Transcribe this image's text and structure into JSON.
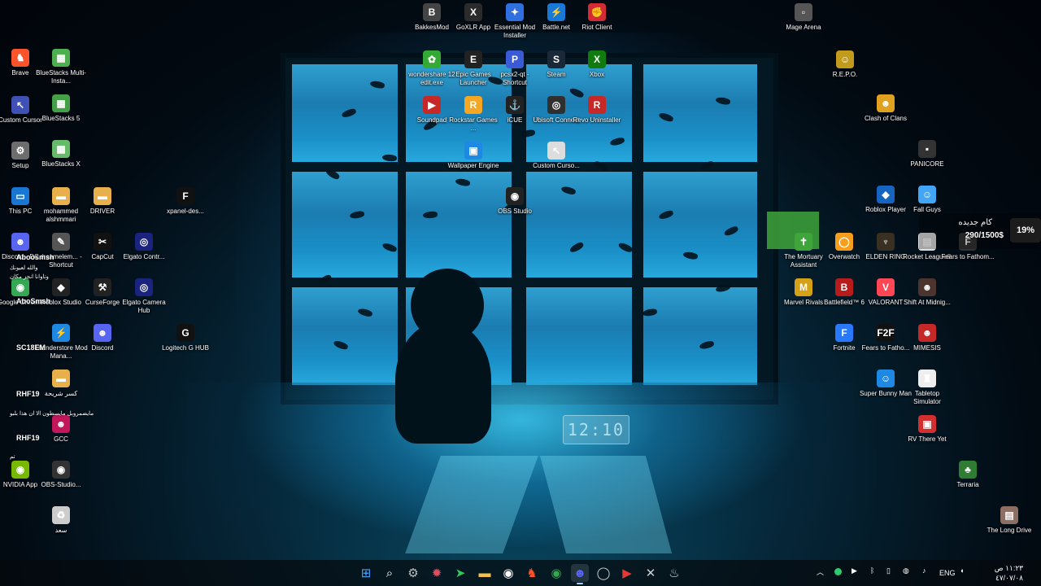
{
  "desktop": {
    "icons": [
      {
        "label": "BakkesMod",
        "color": "#444",
        "glyph": "B"
      },
      {
        "label": "GoXLR App",
        "color": "#2b2b2b",
        "glyph": "X"
      },
      {
        "label": "Essential Mod Installer",
        "color": "#2f6fe0",
        "glyph": "✦"
      },
      {
        "label": "Battle.net",
        "color": "#1a78d6",
        "glyph": "⚡"
      },
      {
        "label": "Riot Client",
        "color": "#d32b36",
        "glyph": "✊"
      },
      {
        "label": "Mage Arena",
        "color": "#555",
        "glyph": "▫"
      },
      {
        "label": "wondershare 12 edit.exe",
        "color": "#3a3",
        "glyph": "✿"
      },
      {
        "label": "Epic Games Launcher",
        "color": "#222",
        "glyph": "E"
      },
      {
        "label": "pcsx2-qt - Shortcut",
        "color": "#3b5bd6",
        "glyph": "P"
      },
      {
        "label": "Steam",
        "color": "#1b2838",
        "glyph": "S"
      },
      {
        "label": "Xbox",
        "color": "#107c10",
        "glyph": "X"
      },
      {
        "label": "R.E.P.O.",
        "color": "#c29a1c",
        "glyph": "☺"
      },
      {
        "label": "Brave",
        "color": "#fb542b",
        "glyph": "♞"
      },
      {
        "label": "BlueStacks Multi-Insta...",
        "color": "#4caf50",
        "glyph": "▦"
      },
      {
        "label": "Soundpad",
        "color": "#c62828",
        "glyph": "▶"
      },
      {
        "label": "Rockstar Games ...",
        "color": "#f5a623",
        "glyph": "R"
      },
      {
        "label": "iCUE",
        "color": "#222",
        "glyph": "⚓"
      },
      {
        "label": "Ubisoft Connect",
        "color": "#2f2f2f",
        "glyph": "◎"
      },
      {
        "label": "Revo Uninstaller",
        "color": "#c62828",
        "glyph": "R"
      },
      {
        "label": "Clash of Clans",
        "color": "#e0a020",
        "glyph": "☻"
      },
      {
        "label": "Custom Cursor",
        "color": "#3f51b5",
        "glyph": "↖"
      },
      {
        "label": "BlueStacks 5",
        "color": "#43a047",
        "glyph": "▦"
      },
      {
        "label": "Wallpaper Engine",
        "color": "#1e88e5",
        "glyph": "▣"
      },
      {
        "label": "Custom Curso...",
        "color": "#ddd",
        "glyph": "↖"
      },
      {
        "label": "PANICORE",
        "color": "#333",
        "glyph": "▪"
      },
      {
        "label": "Setup",
        "color": "#6d6d6d",
        "glyph": "⚙"
      },
      {
        "label": "BlueStacks X",
        "color": "#66bb6a",
        "glyph": "▦"
      },
      {
        "label": "OBS Studio",
        "color": "#222",
        "glyph": "◉"
      },
      {
        "label": "This PC",
        "color": "#1976d2",
        "glyph": "▭"
      },
      {
        "label": "mohammed alshmmari",
        "color": "#e8b04a",
        "glyph": "▬"
      },
      {
        "label": "DRIVER",
        "color": "#e8b04a",
        "glyph": "▬"
      },
      {
        "label": "xpanel-des...",
        "color": "#111",
        "glyph": "F"
      },
      {
        "label": "Roblox Player",
        "color": "#1565c0",
        "glyph": "◆"
      },
      {
        "label": "Fall Guys",
        "color": "#42a5f5",
        "glyph": "☺"
      },
      {
        "label": "Discord - DC",
        "color": "#5865f2",
        "glyph": "☻"
      },
      {
        "label": "dreamelem... - Shortcut",
        "color": "#555",
        "glyph": "✎"
      },
      {
        "label": "CapCut",
        "color": "#111",
        "glyph": "✂"
      },
      {
        "label": "Elgato Contr...",
        "color": "#1a237e",
        "glyph": "◎"
      },
      {
        "label": "The Mortuary Assistant",
        "color": "#3ea53a",
        "glyph": "✝"
      },
      {
        "label": "Overwatch",
        "color": "#f99e1a",
        "glyph": "◯"
      },
      {
        "label": "ELDEN RING",
        "color": "#3a3022",
        "glyph": "♆"
      },
      {
        "label": "Rocket League®",
        "color": "#ddd",
        "glyph": "▤"
      },
      {
        "label": "Fears to Fathom...",
        "color": "#333",
        "glyph": "F"
      },
      {
        "label": "Google Chrome",
        "color": "#34a853",
        "glyph": "◉"
      },
      {
        "label": "Roblox Studio",
        "color": "#222",
        "glyph": "◆"
      },
      {
        "label": "CurseForge",
        "color": "#222",
        "glyph": "⚒"
      },
      {
        "label": "Elgato Camera Hub",
        "color": "#1a237e",
        "glyph": "◎"
      },
      {
        "label": "Marvel Rivals",
        "color": "#d4a017",
        "glyph": "M"
      },
      {
        "label": "Battlefield™ 6",
        "color": "#b71c1c",
        "glyph": "B"
      },
      {
        "label": "VALORANT",
        "color": "#ff4655",
        "glyph": "V"
      },
      {
        "label": "Shift At Midnig...",
        "color": "#4e342e",
        "glyph": "☻"
      },
      {
        "label": "Logitech G HUB",
        "color": "#111",
        "glyph": "G"
      },
      {
        "label": "Thunderstore Mod Mana...",
        "color": "#1e88e5",
        "glyph": "⚡"
      },
      {
        "label": "Discord",
        "color": "#5865f2",
        "glyph": "☻"
      },
      {
        "label": "Fortnite",
        "color": "#2979ff",
        "glyph": "F"
      },
      {
        "label": "Fears to Fatho...",
        "color": "#111",
        "glyph": "F2F"
      },
      {
        "label": "MIMESIS",
        "color": "#c62828",
        "glyph": "☻"
      },
      {
        "label": "كسر شريحة",
        "color": "#e8b04a",
        "glyph": "▬"
      },
      {
        "label": "Super Bunny Man",
        "color": "#1e88e5",
        "glyph": "☺"
      },
      {
        "label": "Tabletop Simulator",
        "color": "#eee",
        "glyph": "♜"
      },
      {
        "label": "GCC",
        "color": "#c2185b",
        "glyph": "☻"
      },
      {
        "label": "RV There Yet",
        "color": "#d32f2f",
        "glyph": "▣"
      },
      {
        "label": "NVIDIA App",
        "color": "#76b900",
        "glyph": "◉"
      },
      {
        "label": "OBS-Studio...",
        "color": "#333",
        "glyph": "◉"
      },
      {
        "label": "Terraria",
        "color": "#2e7d32",
        "glyph": "♣"
      },
      {
        "label": "سعد",
        "color": "#ccc",
        "glyph": "♻"
      },
      {
        "label": "The Long Drive",
        "color": "#8d6e63",
        "glyph": "▤"
      }
    ]
  },
  "overlay": {
    "names": [
      "Aboosmsh",
      "AboSmsh",
      "SC18EM",
      "RHF19",
      "RHF19"
    ],
    "chat": [
      "والله لعيونك",
      "وتاوانا انجز مكان",
      "مايضمروبل مايسطون الا ان هذا بلبو",
      "تم"
    ]
  },
  "widget": {
    "title": "كام جديده",
    "amount": "290/1500$",
    "percent": "19%"
  },
  "wallpaper": {
    "clock_text": "12:10"
  },
  "taskbar": {
    "icons": [
      {
        "name": "start",
        "glyph": "⊞",
        "color": "#4aa3ff"
      },
      {
        "name": "search",
        "glyph": "⌕",
        "color": "#ffffff"
      },
      {
        "name": "settings",
        "glyph": "⚙",
        "color": "#c0c0c0"
      },
      {
        "name": "app-red",
        "glyph": "✹",
        "color": "#e64a5f"
      },
      {
        "name": "app-green",
        "glyph": "➤",
        "color": "#34c759"
      },
      {
        "name": "file-explorer",
        "glyph": "▬",
        "color": "#f2c24b"
      },
      {
        "name": "obs",
        "glyph": "◉",
        "color": "#ffffff"
      },
      {
        "name": "brave",
        "glyph": "♞",
        "color": "#fb542b"
      },
      {
        "name": "chrome",
        "glyph": "◉",
        "color": "#34a853"
      },
      {
        "name": "discord",
        "glyph": "☻",
        "color": "#5865f2"
      },
      {
        "name": "overwatch",
        "glyph": "◯",
        "color": "#cfcfcf"
      },
      {
        "name": "media-player",
        "glyph": "▶",
        "color": "#e53935"
      },
      {
        "name": "goxlr",
        "glyph": "✕",
        "color": "#cfcfcf"
      },
      {
        "name": "steam",
        "glyph": "♨",
        "color": "#cfd8dc"
      }
    ],
    "tray": {
      "language": "ENG",
      "time": "١١:٢٣ ص",
      "date": "٤٧/٠٧/٠٨"
    }
  }
}
